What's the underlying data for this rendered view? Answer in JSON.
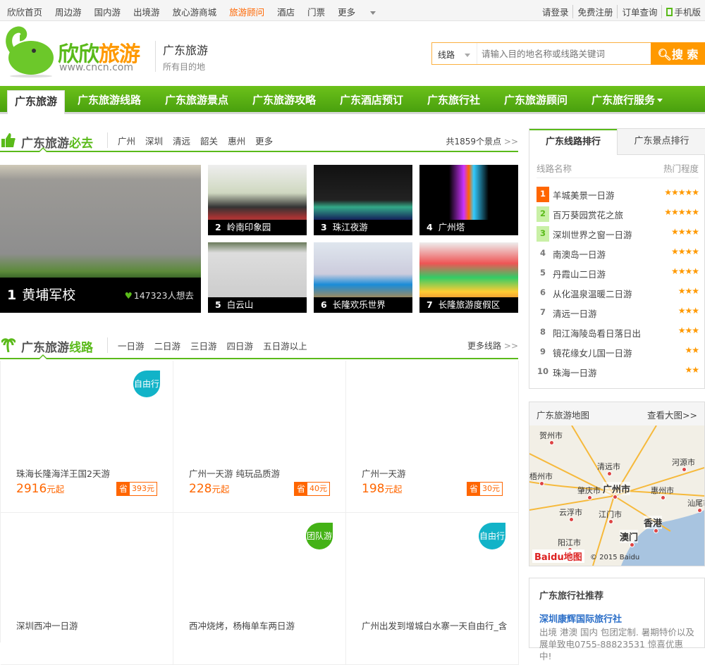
{
  "topbar": {
    "links": [
      "欣欣首页",
      "周边游",
      "国内游",
      "出境游",
      "放心游商城",
      "旅游顾问",
      "酒店",
      "门票",
      "更多"
    ],
    "active_index": 5,
    "right": [
      "请登录",
      "免费注册",
      "订单查询",
      "手机版"
    ]
  },
  "logo": {
    "name_a": "欣欣",
    "name_b": "旅游",
    "url": "www.cncn.com"
  },
  "city": {
    "title": "广东旅游",
    "subtitle": "所有目的地"
  },
  "search": {
    "type": "线路",
    "placeholder": "请输入目的地名称或线路关键词",
    "button": "搜 索"
  },
  "nav": [
    "广东旅游",
    "广东旅游线路",
    "广东旅游景点",
    "广东旅游攻略",
    "广东酒店预订",
    "广东旅行社",
    "广东旅游顾问",
    "广东旅行服务"
  ],
  "must_go": {
    "title_a": "广东旅游",
    "title_b": "必去",
    "tabs": [
      "广州",
      "深圳",
      "清远",
      "韶关",
      "惠州",
      "更多"
    ],
    "more": "共1859个景点",
    "featured": {
      "rank": "1",
      "name": "黄埔军校",
      "likes": "147323人想去"
    },
    "items": [
      {
        "rank": "2",
        "name": "岭南印象园"
      },
      {
        "rank": "3",
        "name": "珠江夜游"
      },
      {
        "rank": "4",
        "name": "广州塔"
      },
      {
        "rank": "5",
        "name": "白云山"
      },
      {
        "rank": "6",
        "name": "长隆欢乐世界"
      },
      {
        "rank": "7",
        "name": "长隆旅游度假区"
      }
    ]
  },
  "routes": {
    "title_a": "广东旅游",
    "title_b": "线路",
    "tabs": [
      "一日游",
      "二日游",
      "三日游",
      "四日游",
      "五日游以上"
    ],
    "more": "更多线路",
    "save_label": "省",
    "yuan_qi": "元起",
    "cards": [
      {
        "name": "珠海长隆海洋王国2天游",
        "price": "2916",
        "save": "393元",
        "tag": "自由行"
      },
      {
        "name": "广州一天游  纯玩品质游",
        "price": "228",
        "save": "40元",
        "tag": ""
      },
      {
        "name": "广州一天游",
        "price": "198",
        "save": "30元",
        "tag": ""
      },
      {
        "name": "深圳西冲一日游",
        "tag": ""
      },
      {
        "name": "西冲烧烤，杨梅单车两日游",
        "tag": "团队游"
      },
      {
        "name": "广州出发到增城白水寨一天自由行_含",
        "tag": "自由行"
      }
    ]
  },
  "colors": {
    "green": "#5aba1a",
    "orange": "#ff6600",
    "teal": "#12b3c8",
    "tag_green": "#44b216"
  },
  "ranking": {
    "tabs": [
      "广东线路排行",
      "广东景点排行"
    ],
    "col_name": "线路名称",
    "col_hot": "热门程度",
    "items": [
      {
        "n": "1",
        "name": "羊城美景一日游",
        "stars": 5
      },
      {
        "n": "2",
        "name": "百万葵园赏花之旅",
        "stars": 5
      },
      {
        "n": "3",
        "name": "深圳世界之窗一日游",
        "stars": 4
      },
      {
        "n": "4",
        "name": "南澳岛一日游",
        "stars": 4
      },
      {
        "n": "5",
        "name": "丹霞山二日游",
        "stars": 4
      },
      {
        "n": "6",
        "name": "从化温泉温暖二日游",
        "stars": 3
      },
      {
        "n": "7",
        "name": "清远一日游",
        "stars": 3
      },
      {
        "n": "8",
        "name": "阳江海陵岛看日落日出",
        "stars": 3
      },
      {
        "n": "9",
        "name": "镜花缘女儿国一日游",
        "stars": 2
      },
      {
        "n": "10",
        "name": "珠海一日游",
        "stars": 2
      }
    ]
  },
  "map": {
    "title": "广东旅游地图",
    "more": "查看大图>>",
    "copyright": "© 2015 Baidu",
    "logo": "Baidu地图",
    "labels": [
      "贺州市",
      "清远市",
      "河源市",
      "梧州市",
      "肇庆市",
      "广州市",
      "惠州市",
      "汕尾市",
      "云浮市",
      "江门市",
      "澳门",
      "香港",
      "阳江市"
    ]
  },
  "agency": {
    "title": "广东旅行社推荐",
    "name": "深圳康辉国际旅行社",
    "desc": "出境 港澳 国内 包团定制. 暑期特价以及展单致电0755-88823531 惊喜优惠中!"
  }
}
